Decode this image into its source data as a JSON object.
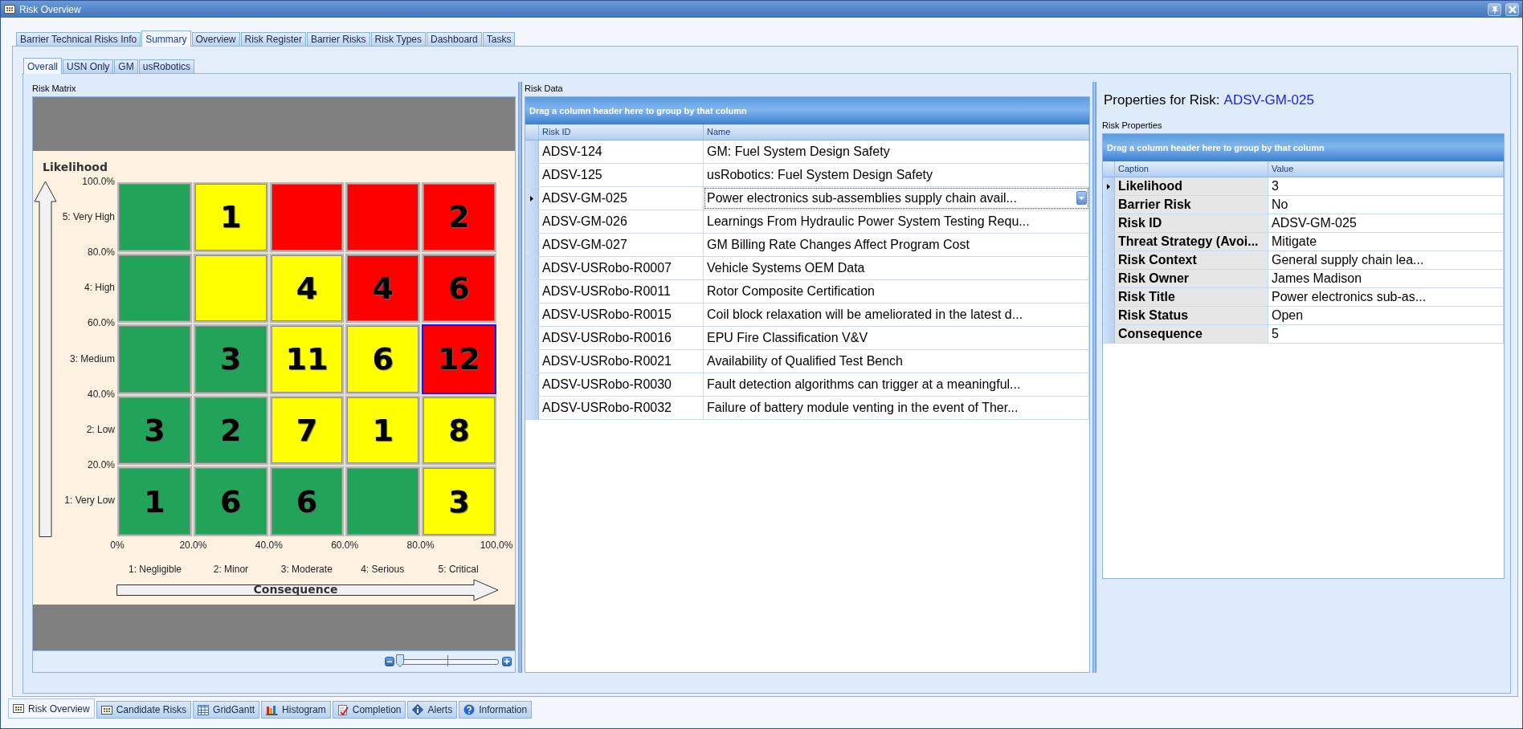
{
  "window": {
    "title": "Risk Overview"
  },
  "tabs": [
    {
      "label": "Barrier Technical Risks Info",
      "selected": false
    },
    {
      "label": "Summary",
      "selected": true
    },
    {
      "label": "Overview",
      "selected": false
    },
    {
      "label": "Risk Register",
      "selected": false
    },
    {
      "label": "Barrier Risks",
      "selected": false
    },
    {
      "label": "Risk Types",
      "selected": false
    },
    {
      "label": "Dashboard",
      "selected": false
    },
    {
      "label": "Tasks",
      "selected": false
    }
  ],
  "sub_tabs": [
    {
      "label": "Overall",
      "selected": true
    },
    {
      "label": "USN Only",
      "selected": false
    },
    {
      "label": "GM",
      "selected": false
    },
    {
      "label": "usRobotics",
      "selected": false
    }
  ],
  "risk_matrix": {
    "title": "Risk Matrix",
    "y_title": "Likelihood",
    "x_title": "Consequence",
    "y_ticks": [
      "100.0%",
      "80.0%",
      "60.0%",
      "40.0%",
      "20.0%"
    ],
    "row_labels": [
      "5: Very High",
      "4: High",
      "3: Medium",
      "2: Low",
      "1: Very Low"
    ],
    "x_ticks": [
      "0%",
      "20.0%",
      "40.0%",
      "60.0%",
      "80.0%",
      "100.0%"
    ],
    "column_labels": [
      "1: Negligible",
      "2: Minor",
      "3: Moderate",
      "4: Serious",
      "5: Critical"
    ],
    "rows": [
      {
        "cells": [
          {
            "color": "#22a35a",
            "selected": false
          },
          {
            "color": "#ffff00",
            "count": "1",
            "selected": false
          },
          {
            "color": "#ff0000",
            "selected": false
          },
          {
            "color": "#ff0000",
            "selected": false
          },
          {
            "color": "#ff0000",
            "count": "2",
            "selected": false
          }
        ]
      },
      {
        "cells": [
          {
            "color": "#22a35a",
            "selected": false
          },
          {
            "color": "#ffff00",
            "selected": false
          },
          {
            "color": "#ffff00",
            "count": "4",
            "selected": false
          },
          {
            "color": "#ff0000",
            "count": "4",
            "selected": false
          },
          {
            "color": "#ff0000",
            "count": "6",
            "selected": false
          }
        ]
      },
      {
        "cells": [
          {
            "color": "#22a35a",
            "selected": false
          },
          {
            "color": "#22a35a",
            "count": "3",
            "selected": false
          },
          {
            "color": "#ffff00",
            "count": "11",
            "selected": false
          },
          {
            "color": "#ffff00",
            "count": "6",
            "selected": false
          },
          {
            "color": "#ff0000",
            "count": "12",
            "selected": true
          }
        ]
      },
      {
        "cells": [
          {
            "color": "#22a35a",
            "count": "3",
            "selected": false
          },
          {
            "color": "#22a35a",
            "count": "2",
            "selected": false
          },
          {
            "color": "#ffff00",
            "count": "7",
            "selected": false
          },
          {
            "color": "#ffff00",
            "count": "1",
            "selected": false
          },
          {
            "color": "#ffff00",
            "count": "8",
            "selected": false
          }
        ]
      },
      {
        "cells": [
          {
            "color": "#22a35a",
            "count": "1",
            "selected": false
          },
          {
            "color": "#22a35a",
            "count": "6",
            "selected": false
          },
          {
            "color": "#22a35a",
            "count": "6",
            "selected": false
          },
          {
            "color": "#22a35a",
            "selected": false
          },
          {
            "color": "#ffff00",
            "count": "3",
            "selected": false
          }
        ]
      }
    ],
    "zoom": {
      "level": 0
    }
  },
  "risk_data": {
    "title": "Risk Data",
    "group_panel": "Drag a column header here to group by that column",
    "columns": [
      "Risk ID",
      "Name"
    ],
    "rows": [
      {
        "risk_id": "ADSV-124",
        "name": "GM: Fuel System Design Safety",
        "selected": false
      },
      {
        "risk_id": "ADSV-125",
        "name": "usRobotics: Fuel System Design Safety",
        "selected": false
      },
      {
        "risk_id": "ADSV-GM-025",
        "name": "Power electronics sub-assemblies supply chain avail...",
        "selected": true
      },
      {
        "risk_id": "ADSV-GM-026",
        "name": "Learnings From Hydraulic Power System Testing Requ...",
        "selected": false
      },
      {
        "risk_id": "ADSV-GM-027",
        "name": "GM Billing Rate Changes Affect Program Cost",
        "selected": false
      },
      {
        "risk_id": "ADSV-USRobo-R0007",
        "name": "Vehicle Systems OEM Data",
        "selected": false
      },
      {
        "risk_id": "ADSV-USRobo-R0011",
        "name": "Rotor Composite Certification",
        "selected": false
      },
      {
        "risk_id": "ADSV-USRobo-R0015",
        "name": "Coil block relaxation will be ameliorated in the latest d...",
        "selected": false
      },
      {
        "risk_id": "ADSV-USRobo-R0016",
        "name": "EPU Fire Classification V&V",
        "selected": false
      },
      {
        "risk_id": "ADSV-USRobo-R0021",
        "name": "Availability of Qualified Test Bench",
        "selected": false
      },
      {
        "risk_id": "ADSV-USRobo-R0030",
        "name": "Fault detection algorithms can trigger at a meaningful...",
        "selected": false
      },
      {
        "risk_id": "ADSV-USRobo-R0032",
        "name": "Failure of battery module venting in the event of Ther...",
        "selected": false
      }
    ]
  },
  "properties": {
    "heading": "Properties for Risk:",
    "heading_id": "ADSV-GM-025",
    "title": "Risk Properties",
    "group_panel": "Drag a column header here to group by that column",
    "columns": [
      "Caption",
      "Value"
    ],
    "rows": [
      {
        "caption": "Likelihood",
        "value": "3",
        "selected": true
      },
      {
        "caption": "Barrier Risk",
        "value": "No",
        "selected": false
      },
      {
        "caption": "Risk ID",
        "value": "ADSV-GM-025",
        "selected": false
      },
      {
        "caption": "Threat Strategy (Avoi...",
        "value": "Mitigate",
        "selected": false
      },
      {
        "caption": "Risk Context",
        "value": "General supply chain lea...",
        "selected": false
      },
      {
        "caption": "Risk Owner",
        "value": "James Madison",
        "selected": false
      },
      {
        "caption": "Risk Title",
        "value": "Power electronics sub-as...",
        "selected": false
      },
      {
        "caption": "Risk Status",
        "value": "Open",
        "selected": false
      },
      {
        "caption": "Consequence",
        "value": "5",
        "selected": false
      }
    ]
  },
  "bottom_tabs": [
    {
      "label": "Risk Overview",
      "kind": "grid",
      "selected": true
    },
    {
      "label": "Candidate Risks",
      "kind": "grid",
      "selected": false
    },
    {
      "label": "GridGantt",
      "kind": "table",
      "selected": false
    },
    {
      "label": "Histogram",
      "kind": "bars",
      "selected": false
    },
    {
      "label": "Completion",
      "kind": "checklist",
      "selected": false
    },
    {
      "label": "Alerts",
      "kind": "alert",
      "selected": false
    },
    {
      "label": "Information",
      "kind": "help",
      "selected": false
    }
  ]
}
